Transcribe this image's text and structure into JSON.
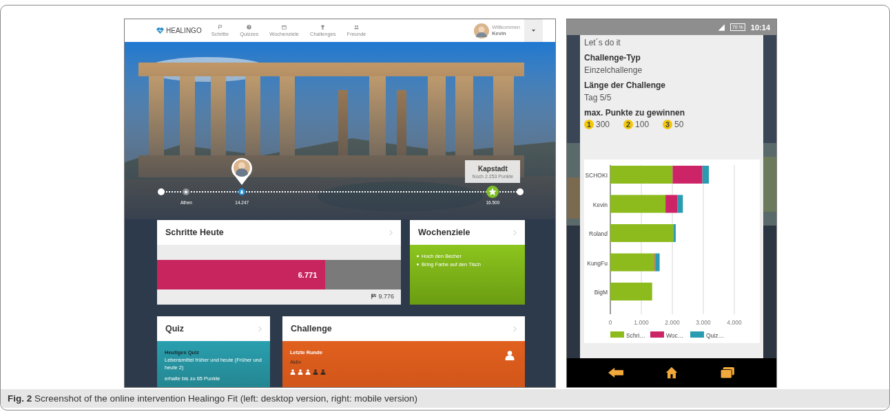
{
  "desktop": {
    "navbar": {
      "logo": "HEALINGO",
      "items": [
        {
          "label": "Schritte"
        },
        {
          "label": "Quizzes"
        },
        {
          "label": "Wochenziele"
        },
        {
          "label": "Challenges"
        },
        {
          "label": "Freunde"
        }
      ],
      "greeting": "Willkommen",
      "user": "Kevin"
    },
    "timeline": {
      "markers": [
        {
          "kind": "endpoint",
          "level": 0
        },
        {
          "kind": "city",
          "label": "Athen",
          "level": 0.07
        },
        {
          "kind": "user",
          "label": "14.247",
          "level": 0.225
        },
        {
          "kind": "goal",
          "label": "16.500",
          "level": 0.924
        },
        {
          "kind": "endpoint",
          "level": 1
        }
      ],
      "tooltip": {
        "title": "Kapstadt",
        "text": "Noch 2.253 Punkte"
      }
    },
    "steps_card": {
      "title": "Schritte Heute",
      "value": "6.771",
      "level": 0.69,
      "goal": "9.776"
    },
    "goals_card": {
      "title": "Wochenziele",
      "items": [
        "Hoch den Becher",
        "Bring Farbe auf den Tisch"
      ]
    },
    "quiz_card": {
      "title": "Quiz",
      "heading": "Heutiges Quiz",
      "text": "Lebensmittel früher und heute (Früher und heute 2)",
      "points": "erhalte bis zu 65 Punkte"
    },
    "challenge_card": {
      "title": "Challenge",
      "heading": "Letzte Runde",
      "status": "Aktiv",
      "participants": [
        {
          "active": true
        },
        {
          "active": true
        },
        {
          "active": true
        },
        {
          "active": false
        },
        {
          "active": false
        }
      ]
    }
  },
  "mobile": {
    "status_bar": {
      "battery": "70 %",
      "time": "10:14"
    },
    "title": "Let´s do it",
    "fields": [
      {
        "label": "Challenge-Typ",
        "value": "Einzelchallenge"
      },
      {
        "label": "Länge der Challenge",
        "value": "Tag 5/5"
      }
    ],
    "points_label": "max. Punkte zu gewinnen",
    "points": [
      {
        "rank": "1",
        "value": "300"
      },
      {
        "rank": "2",
        "value": "100"
      },
      {
        "rank": "3",
        "value": "50"
      }
    ],
    "chart_data": {
      "type": "bar",
      "orientation": "horizontal",
      "stacked": true,
      "categories": [
        "SCHOKI",
        "Kevin",
        "Roland",
        "KungFu",
        "BigM"
      ],
      "series": [
        {
          "name": "Schri…",
          "color": "#8dbb1e",
          "values": [
            2010,
            1780,
            2030,
            1430,
            1350
          ]
        },
        {
          "name": "Woc…",
          "color": "#cc2466",
          "values": [
            960,
            390,
            null,
            20,
            null
          ]
        },
        {
          "name": "Quiz…",
          "color": "#2a9bb0",
          "values": [
            210,
            170,
            80,
            140,
            null
          ]
        }
      ],
      "grid": true,
      "legend": true,
      "xlim": [
        0,
        4000
      ],
      "xticks": [
        {
          "value": 0,
          "label": "0"
        },
        {
          "value": 1000,
          "label": "1.000"
        },
        {
          "value": 2000,
          "label": "2.000"
        },
        {
          "value": 3000,
          "label": "3.000"
        },
        {
          "value": 4000,
          "label": "4.000"
        }
      ]
    }
  },
  "caption": "**Fig. 2** Screenshot of the online intervention Healingo Fit (left: desktop version, right: mobile version)"
}
